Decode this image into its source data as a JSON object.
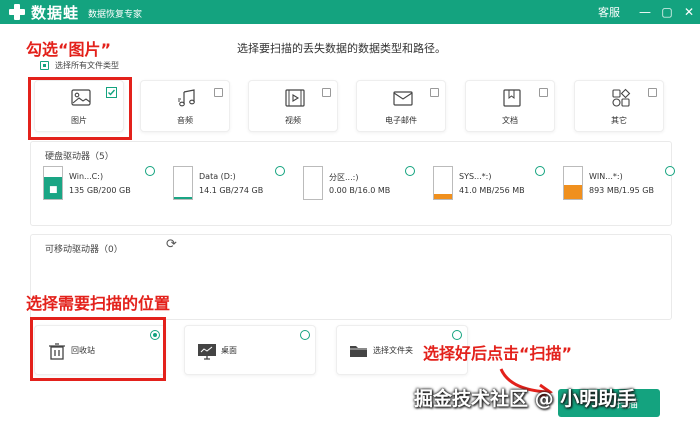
{
  "titlebar": {
    "app_name": "数据蛙",
    "subtitle": "数据恢复专家",
    "service": "客服",
    "minimize": "—",
    "restore": "▢",
    "close": "✕"
  },
  "heading": "选择要扫描的丢失数据的数据类型和路径。",
  "select_all": {
    "label": "选择所有文件类型",
    "checked": true
  },
  "file_types": [
    {
      "label": "图片",
      "checked": true,
      "icon": "image-icon"
    },
    {
      "label": "音频",
      "checked": false,
      "icon": "music-icon"
    },
    {
      "label": "视频",
      "checked": false,
      "icon": "video-icon"
    },
    {
      "label": "电子邮件",
      "checked": false,
      "icon": "mail-icon"
    },
    {
      "label": "文档",
      "checked": false,
      "icon": "document-icon"
    },
    {
      "label": "其它",
      "checked": false,
      "icon": "other-icon"
    }
  ],
  "hard_drives": {
    "title": "硬盘驱动器（5）",
    "items": [
      {
        "name": "Win...C:)",
        "size": "135 GB/200 GB",
        "used_fraction": 0.675,
        "fill_color": "#1aa584",
        "selected": false
      },
      {
        "name": "Data (D:)",
        "size": "14.1 GB/274 GB",
        "used_fraction": 0.051,
        "fill_color": "#1aa584",
        "selected": false
      },
      {
        "name": "分区...:)",
        "size": "0.00  B/16.0 MB",
        "used_fraction": 0.0,
        "fill_color": "#1aa584",
        "selected": false
      },
      {
        "name": "SYS...*:)",
        "size": "41.0 MB/256 MB",
        "used_fraction": 0.16,
        "fill_color": "#f0901e",
        "selected": false
      },
      {
        "name": "WIN...*:)",
        "size": "893 MB/1.95 GB",
        "used_fraction": 0.447,
        "fill_color": "#f0901e",
        "selected": false
      }
    ]
  },
  "removable": {
    "title": "可移动驱动器（0）"
  },
  "locations": [
    {
      "label": "回收站",
      "icon": "trash-icon",
      "selected": true
    },
    {
      "label": "桌面",
      "icon": "desktop-icon",
      "selected": false
    },
    {
      "label": "选择文件夹",
      "icon": "folder-icon",
      "selected": false
    }
  ],
  "next_button": "扫描",
  "annotations": {
    "pick_image": "勾选“图片”",
    "pick_location": "选择需要扫描的位置",
    "then_scan": "选择好后点击“扫描”"
  },
  "watermark": "掘金技术社区 @ 小明助手",
  "colors": {
    "brand": "#14a37f",
    "annotation_red": "#e3211b",
    "system_fill": "#f0901e"
  }
}
